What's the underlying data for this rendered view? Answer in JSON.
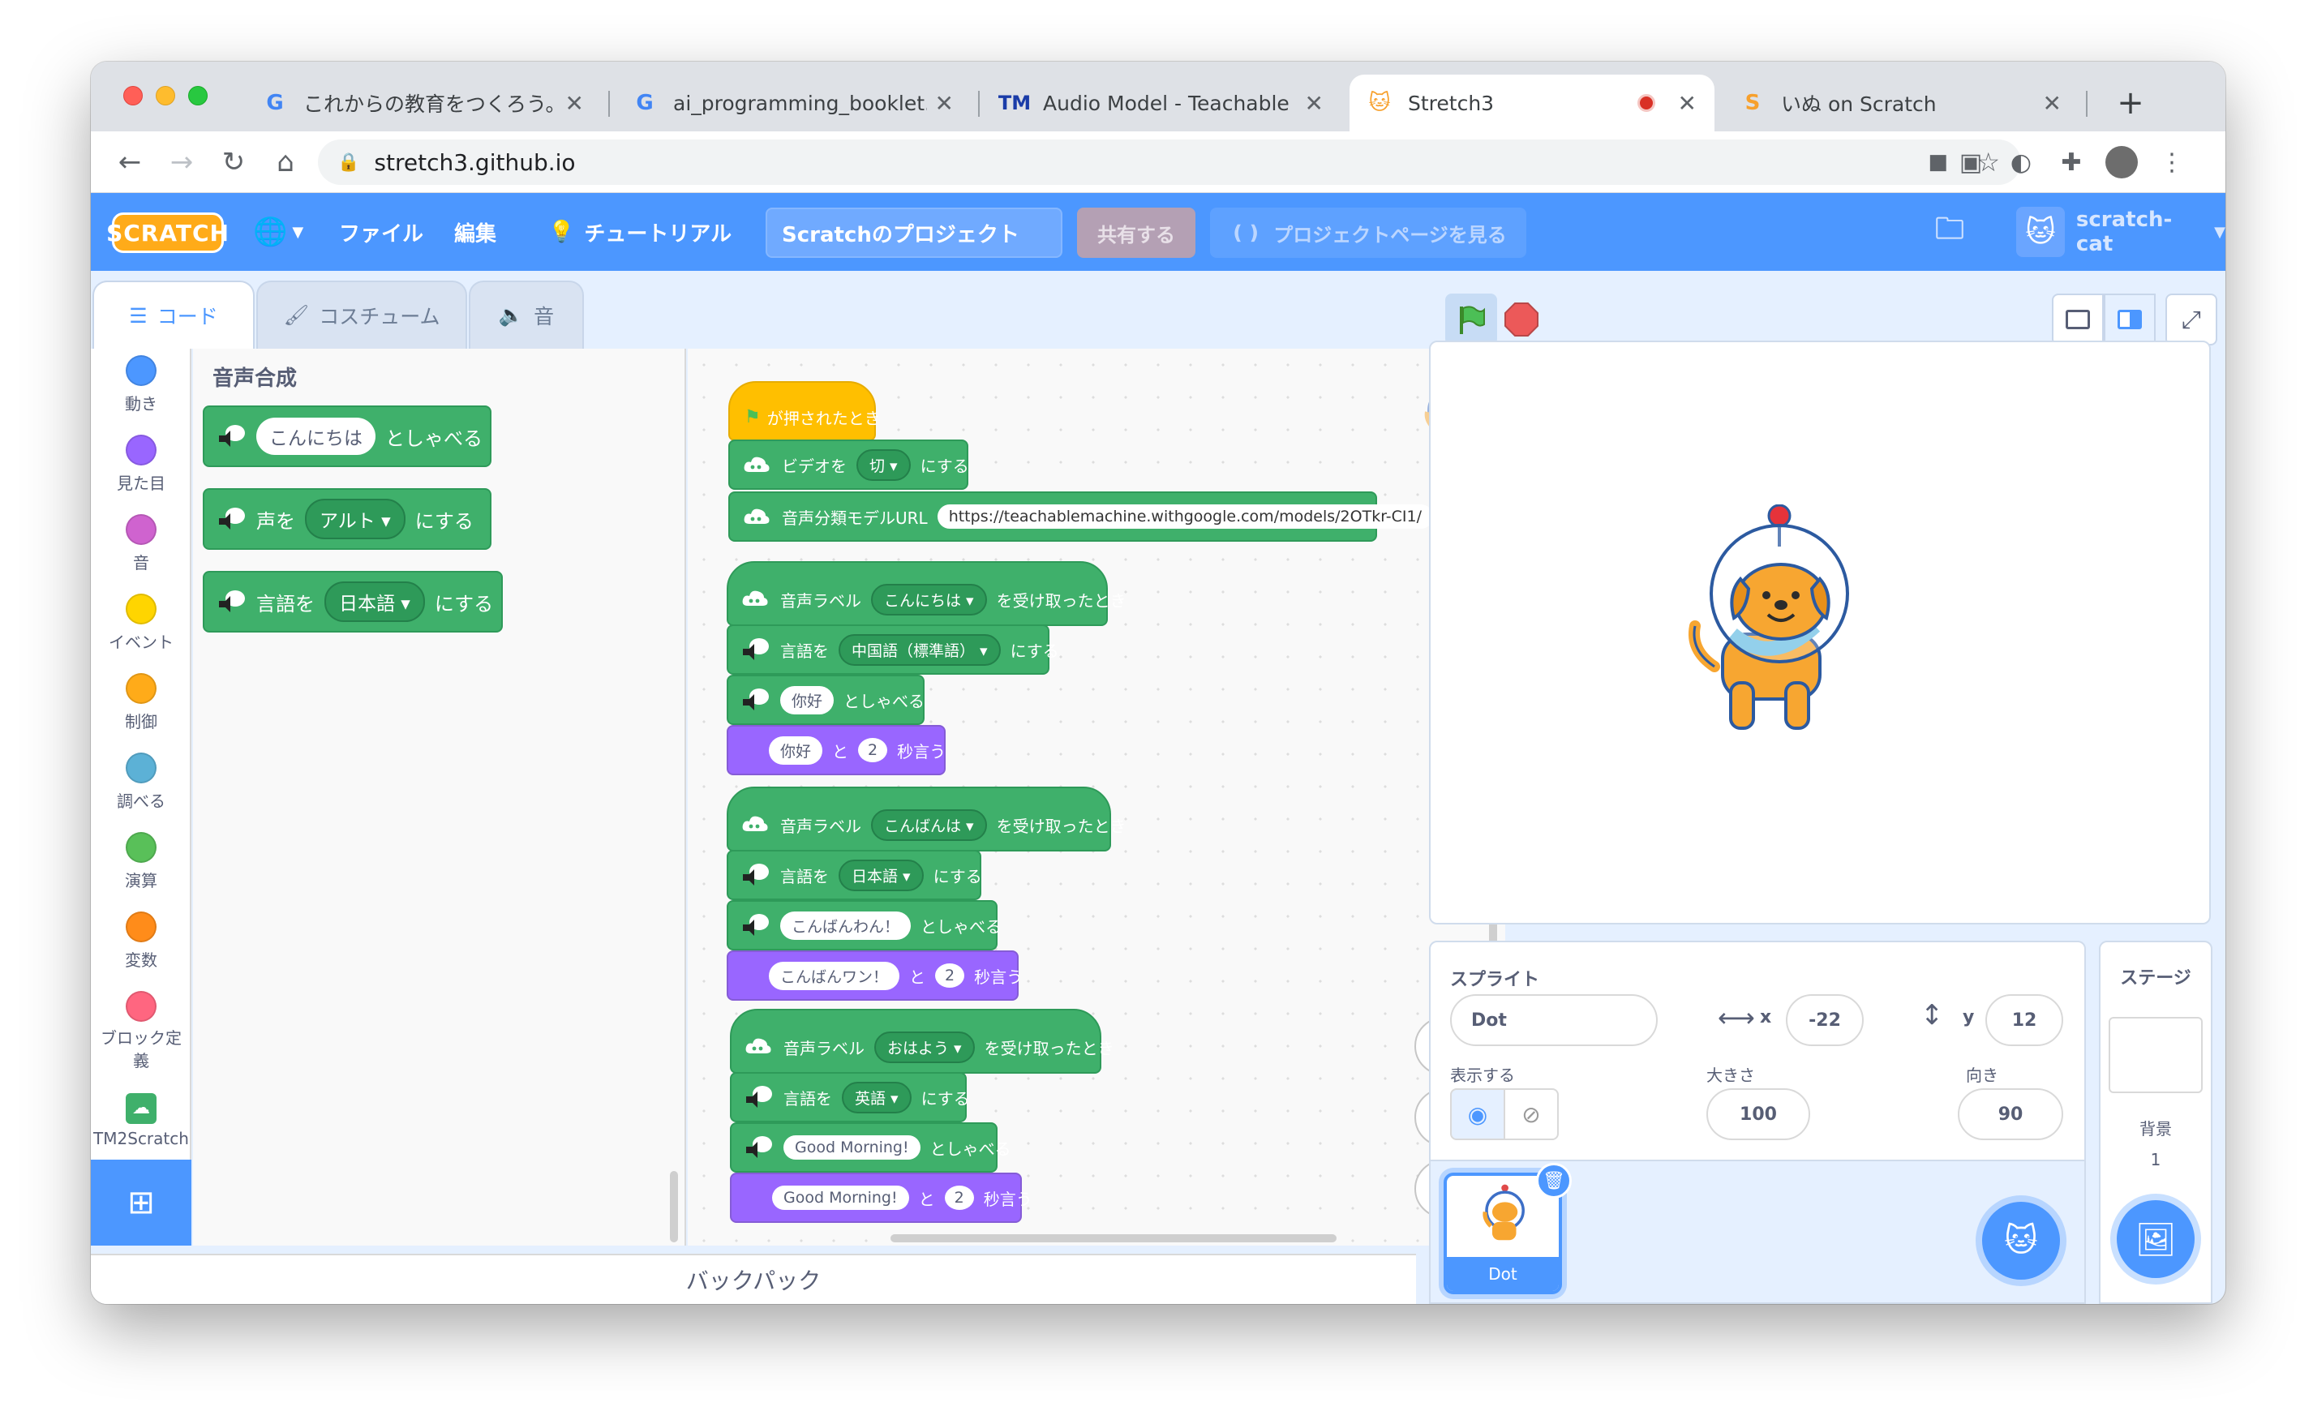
{
  "browser": {
    "tabs": [
      {
        "title": "これからの教育をつくろう。",
        "favicon": "google-icon"
      },
      {
        "title": "ai_programming_booklet.pdf",
        "favicon": "google-icon"
      },
      {
        "title": "Audio Model - Teachable Ma",
        "favicon": "teachable-machine-icon"
      },
      {
        "title": "Stretch3",
        "favicon": "scratch-cat-icon"
      },
      {
        "title": "いぬ on Scratch",
        "favicon": "scratch-s-icon"
      }
    ],
    "new_tab": "+",
    "url": "stretch3.github.io"
  },
  "menubar": {
    "logo": "SCRATCH",
    "file": "ファイル",
    "edit": "編集",
    "tutorial": "チュートリアル",
    "project_title": "Scratchのプロジェクト",
    "share": "共有する",
    "project_page": "プロジェクトページを見る",
    "username": "scratch-cat"
  },
  "editor_tabs": {
    "code": "コード",
    "costume": "コスチューム",
    "sound": "音"
  },
  "categories": [
    {
      "label": "動き",
      "color": "#4c97ff"
    },
    {
      "label": "見た目",
      "color": "#9966ff"
    },
    {
      "label": "音",
      "color": "#cf63cf"
    },
    {
      "label": "イベント",
      "color": "#ffd500"
    },
    {
      "label": "制御",
      "color": "#ffab19"
    },
    {
      "label": "調べる",
      "color": "#5cb1d6"
    },
    {
      "label": "演算",
      "color": "#59c059"
    },
    {
      "label": "変数",
      "color": "#ff8c1a"
    },
    {
      "label": "ブロック定義",
      "color": "#ff6680"
    },
    {
      "label": "TM2Scratch",
      "color": "#3fb06b"
    }
  ],
  "palette": {
    "title": "音声合成",
    "b1": {
      "pill": "こんにちは",
      "text": "としゃべる"
    },
    "b2": {
      "pre": "声を",
      "drop": "アルト",
      "post": "にする"
    },
    "b3": {
      "pre": "言語を",
      "drop": "日本語",
      "post": "にする"
    }
  },
  "scripts": {
    "s0": {
      "hat": "が押されたとき",
      "video_pre": "ビデオを",
      "video_drop": "切",
      "video_post": "にする",
      "url_label": "音声分類モデルURL",
      "url_value": "https://teachablemachine.withgoogle.com/models/2OTkr-CI1/"
    },
    "s1": {
      "hat_pre": "音声ラベル",
      "hat_drop": "こんにちは",
      "hat_post": "を受け取ったとき",
      "lang_pre": "言語を",
      "lang_drop": "中国語（標準語）",
      "lang_post": "にする",
      "speak_pill": "你好",
      "speak_text": "としゃべる",
      "say_pill": "你好",
      "say_and": "と",
      "say_num": "2",
      "say_post": "秒言う"
    },
    "s2": {
      "hat_pre": "音声ラベル",
      "hat_drop": "こんばんは",
      "hat_post": "を受け取ったとき",
      "lang_pre": "言語を",
      "lang_drop": "日本語",
      "lang_post": "にする",
      "speak_pill": "こんばんわん！",
      "speak_text": "としゃべる",
      "say_pill": "こんばんワン！",
      "say_and": "と",
      "say_num": "2",
      "say_post": "秒言う"
    },
    "s3": {
      "hat_pre": "音声ラベル",
      "hat_drop": "おはよう",
      "hat_post": "を受け取ったとき",
      "lang_pre": "言語を",
      "lang_drop": "英語",
      "lang_post": "にする",
      "speak_pill": "Good Morning!",
      "speak_text": "としゃべる",
      "say_pill": "Good Morning!",
      "say_and": "と",
      "say_num": "2",
      "say_post": "秒言う"
    }
  },
  "zoom": {
    "in": "+",
    "out": "−",
    "reset": "="
  },
  "backpack": "バックパック",
  "sprite_info": {
    "title": "スプライト",
    "name": "Dot",
    "x_label": "x",
    "x": "-22",
    "y_label": "y",
    "y": "12",
    "show_label": "表示する",
    "size_label": "大きさ",
    "size": "100",
    "direction_label": "向き",
    "direction": "90"
  },
  "sprite_thumb": {
    "name": "Dot"
  },
  "stage_panel": {
    "title": "ステージ",
    "backdrop_label": "背景",
    "backdrop_count": "1"
  },
  "colors": {
    "scratch_blue": "#4c97ff",
    "tm_green": "#3fb06b",
    "looks_purple": "#9966ff",
    "events_yellow": "#ffbf00"
  }
}
